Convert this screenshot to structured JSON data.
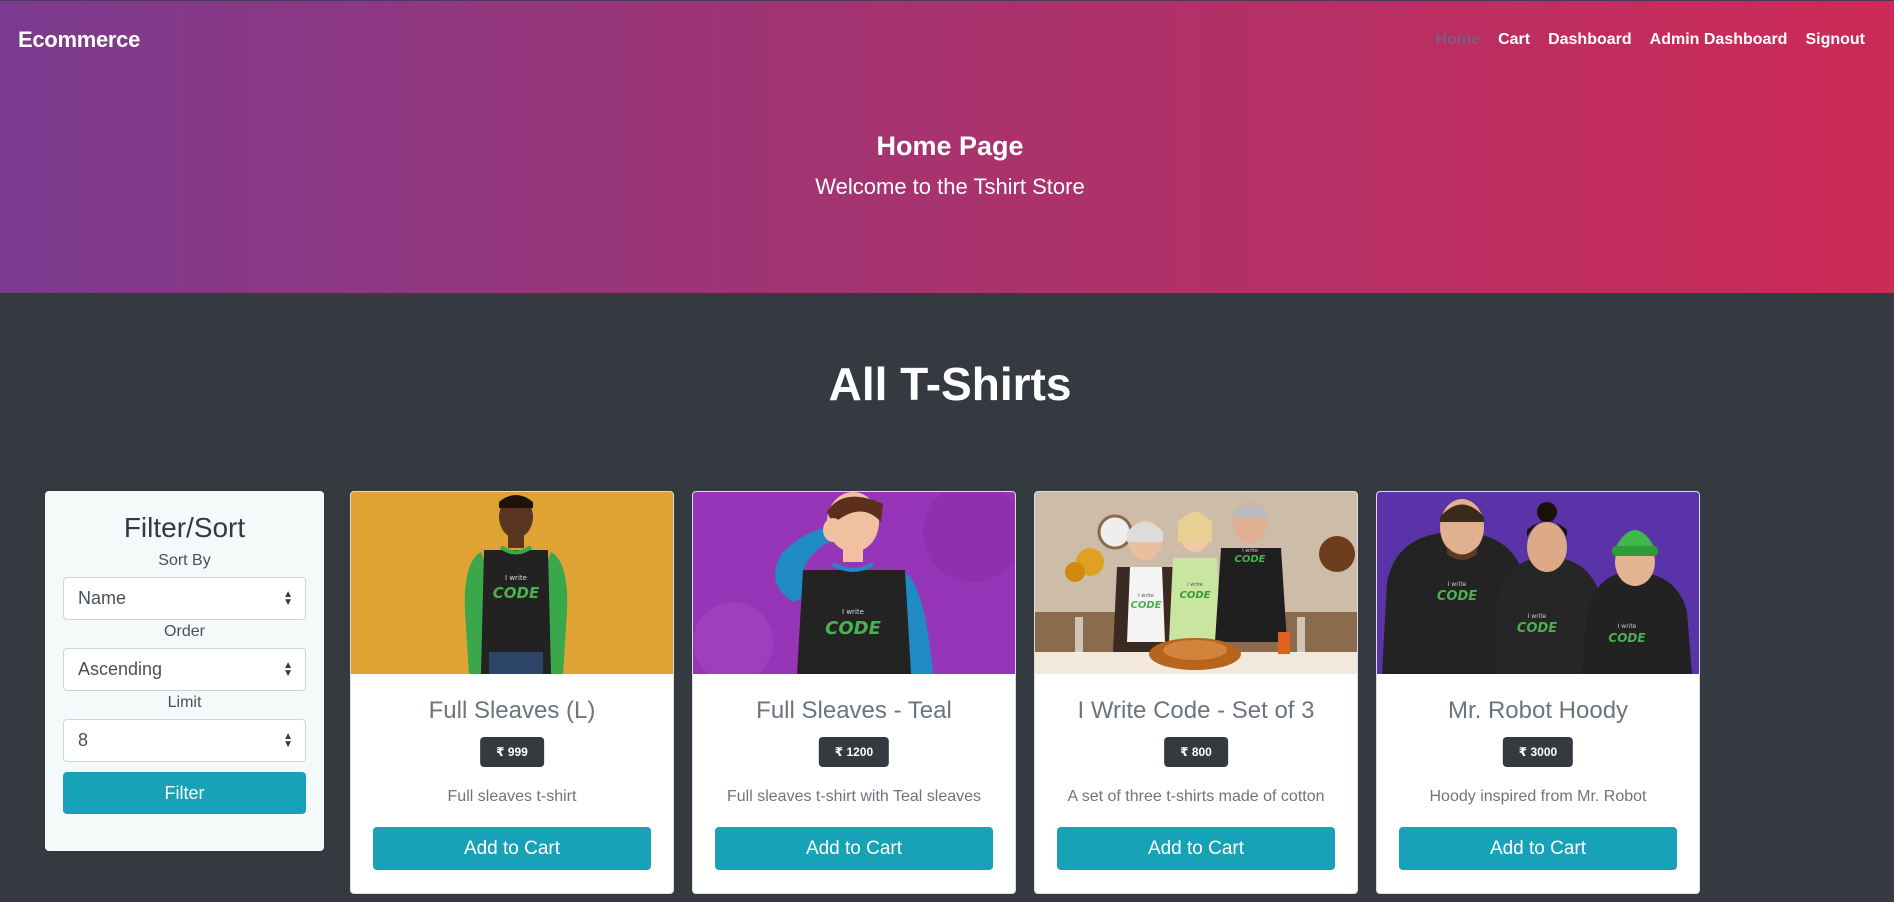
{
  "navbar": {
    "brand": "Ecommerce",
    "links": [
      "Home",
      "Cart",
      "Dashboard",
      "Admin Dashboard",
      "Signout"
    ],
    "active": "Home"
  },
  "hero": {
    "title": "Home Page",
    "subtitle": "Welcome to the Tshirt Store"
  },
  "section": {
    "title": "All T-Shirts"
  },
  "filter": {
    "title": "Filter/Sort",
    "sort_label": "Sort By",
    "sort_value": "Name",
    "order_label": "Order",
    "order_value": "Ascending",
    "limit_label": "Limit",
    "limit_value": "8",
    "button_label": "Filter"
  },
  "products": [
    {
      "name": "Full Sleaves (L)",
      "price": "₹ 999",
      "description": "Full sleaves t-shirt",
      "button": "Add to Cart",
      "image": "man-green-sleeves-yellow-background"
    },
    {
      "name": "Full Sleaves - Teal",
      "price": "₹ 1200",
      "description": "Full sleaves t-shirt with Teal sleaves",
      "button": "Add to Cart",
      "image": "woman-teal-sleeves-purple-background"
    },
    {
      "name": "I Write Code - Set of 3",
      "price": "₹ 800",
      "description": "A set of three t-shirts made of cotton",
      "button": "Add to Cart",
      "image": "family-three-tshirts-dinner-table"
    },
    {
      "name": "Mr. Robot Hoody",
      "price": "₹ 3000",
      "description": "Hoody inspired from Mr. Robot",
      "button": "Add to Cart",
      "image": "three-people-hoodies-purple-background"
    }
  ],
  "image_print": {
    "small": "I write",
    "big": "CODE"
  },
  "colors": {
    "accent": "#17a2b8",
    "dark": "#343a40",
    "gradient_start": "#7b3a8f",
    "gradient_end": "#cc2a57",
    "code_green": "#4caf50"
  }
}
